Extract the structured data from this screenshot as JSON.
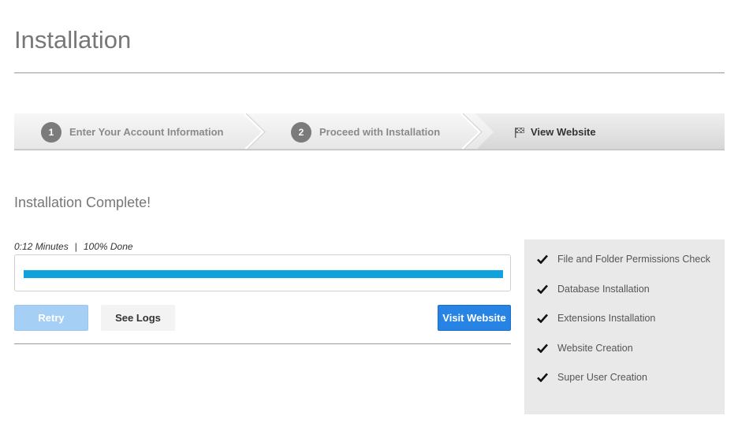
{
  "page": {
    "title": "Installation"
  },
  "wizard": {
    "steps": [
      {
        "number": "1",
        "label": "Enter Your Account Information"
      },
      {
        "number": "2",
        "label": "Proceed with Installation"
      },
      {
        "label": "View Website",
        "icon": "checkered-flag-icon"
      }
    ]
  },
  "main": {
    "heading": "Installation Complete!",
    "elapsed": "0:12 Minutes",
    "separator": "|",
    "done": "100% Done",
    "progress_percent": 100,
    "buttons": {
      "retry": "Retry",
      "logs": "See Logs",
      "visit": "Visit Website"
    }
  },
  "checklist": {
    "items": [
      "File and Folder Permissions Check",
      "Database Installation",
      "Extensions Installation",
      "Website Creation",
      "Super User Creation"
    ]
  },
  "colors": {
    "progress": "#0ea3dd",
    "visit_button": "#2784e4",
    "retry_button": "#a6cff5"
  }
}
